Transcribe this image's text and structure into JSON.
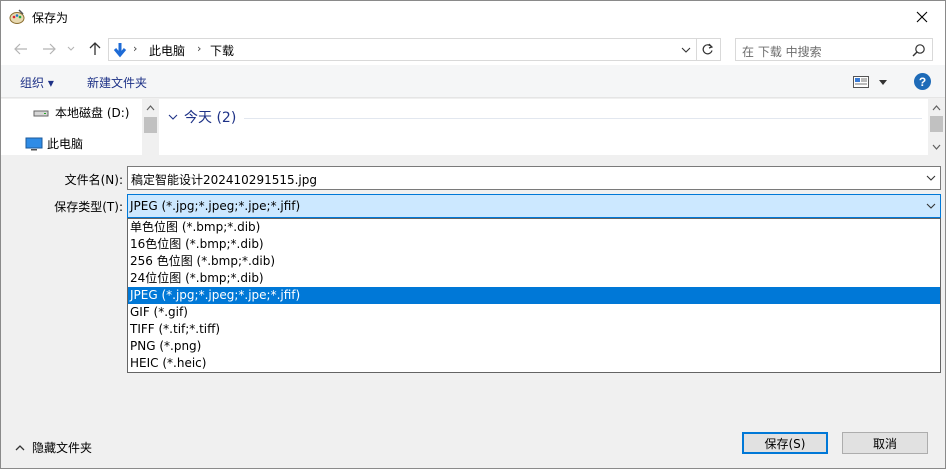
{
  "window": {
    "title": "保存为"
  },
  "nav": {
    "crumbs": [
      "此电脑",
      "下载"
    ],
    "search_placeholder": "在 下载 中搜索"
  },
  "toolbar": {
    "organize_label": "组织 ▾",
    "new_folder_label": "新建文件夹",
    "help_label": "?"
  },
  "tree": {
    "items": [
      "本地磁盘 (D:)",
      "此电脑"
    ]
  },
  "files": {
    "group_header": "今天 (2)"
  },
  "form": {
    "filename_label": "文件名(N):",
    "filename_value": "稿定智能设计202410291515.jpg",
    "type_label": "保存类型(T):",
    "type_value": "JPEG (*.jpg;*.jpeg;*.jpe;*.jfif)",
    "type_options": [
      "单色位图 (*.bmp;*.dib)",
      "16色位图 (*.bmp;*.dib)",
      "256 色位图 (*.bmp;*.dib)",
      "24位位图 (*.bmp;*.dib)",
      "JPEG (*.jpg;*.jpeg;*.jpe;*.jfif)",
      "GIF (*.gif)",
      "TIFF (*.tif;*.tiff)",
      "PNG (*.png)",
      "HEIC (*.heic)"
    ],
    "selected_index": 4
  },
  "footer": {
    "hide_folders_label": "隐藏文件夹",
    "save_label": "保存(S)",
    "cancel_label": "取消"
  },
  "colors": {
    "accent": "#0078d7",
    "link": "#1e3287"
  }
}
